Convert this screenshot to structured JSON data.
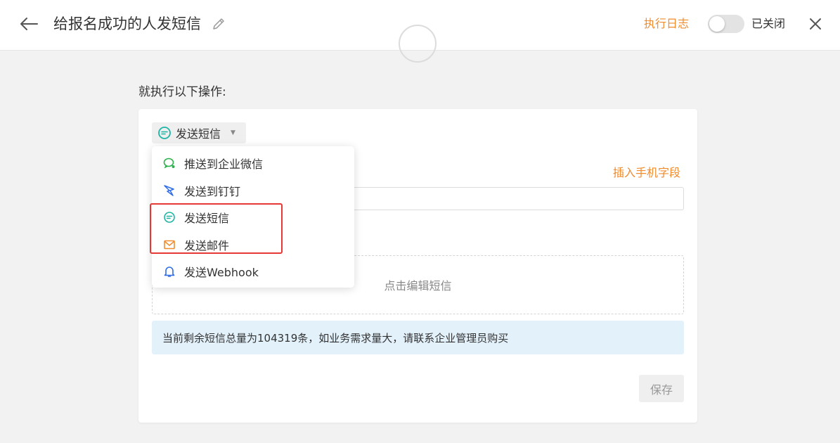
{
  "header": {
    "title": "给报名成功的人发短信",
    "log_link": "执行日志",
    "toggle_state": "已关闭"
  },
  "section": {
    "label": "就执行以下操作:"
  },
  "action": {
    "selected_label": "发送短信",
    "selected_icon": "sms-icon",
    "insert_phone_link": "插入手机字段",
    "phone_input_value": "",
    "sms_editor_placeholder": "点击编辑短信",
    "info": "当前剩余短信总量为104319条，如业务需求量大，请联系企业管理员购买",
    "save_label": "保存"
  },
  "menu": {
    "items": [
      {
        "label": "推送到企业微信",
        "icon": "wecom-icon",
        "color": "#2bb24c"
      },
      {
        "label": "发送到钉钉",
        "icon": "dingtalk-icon",
        "color": "#2f6ce5"
      },
      {
        "label": "发送短信",
        "icon": "sms-icon",
        "color": "#1fb5a6"
      },
      {
        "label": "发送邮件",
        "icon": "mail-icon",
        "color": "#f08c2e"
      },
      {
        "label": "发送Webhook",
        "icon": "bell-icon",
        "color": "#2f6ce5"
      }
    ]
  },
  "colors": {
    "accent_orange": "#f08c2e",
    "highlight_red": "#e53935",
    "info_bg": "#e3f1fb"
  }
}
